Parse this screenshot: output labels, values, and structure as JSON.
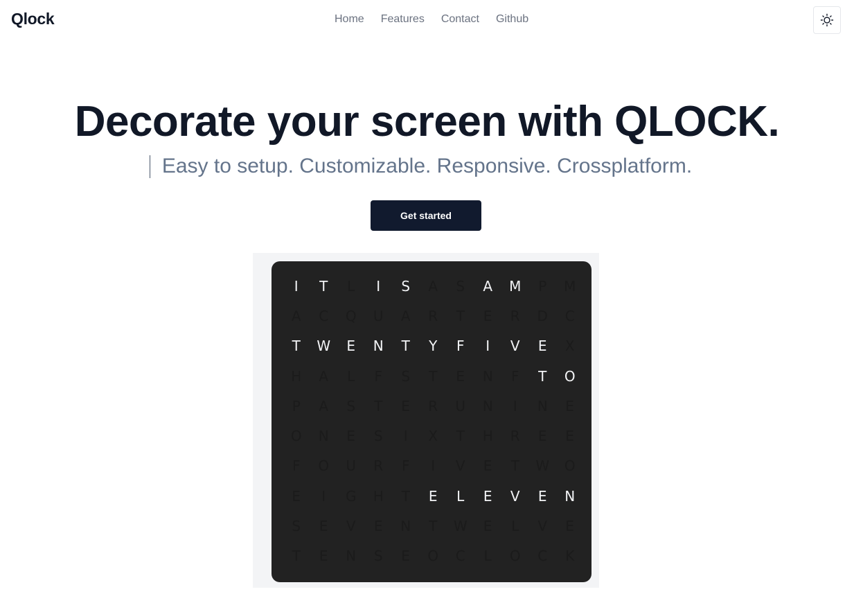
{
  "brand": "Qlock",
  "nav": {
    "links": [
      "Home",
      "Features",
      "Contact",
      "Github"
    ]
  },
  "theme_toggle": {
    "icon": "sun-icon"
  },
  "hero": {
    "title": "Decorate your screen with QLOCK.",
    "subtitle": "Easy to setup. Customizable. Responsive. Crossplatform.",
    "cta_label": "Get started"
  },
  "clock": {
    "rows": [
      "ITLISASAMPM",
      "ACQUARTERDC",
      "TWENTYFIVEX",
      "HALFSTENFTO",
      "PASTERUNINE",
      "ONESIXTHREE",
      "FOURFIVETWO",
      "EIGHTELEVEN",
      "SEVENTWELVE",
      "TENSEOCLOCK"
    ],
    "lit": [
      [
        0,
        0
      ],
      [
        0,
        1
      ],
      [
        0,
        3
      ],
      [
        0,
        4
      ],
      [
        0,
        7
      ],
      [
        0,
        8
      ],
      [
        2,
        0
      ],
      [
        2,
        1
      ],
      [
        2,
        2
      ],
      [
        2,
        3
      ],
      [
        2,
        4
      ],
      [
        2,
        5
      ],
      [
        2,
        6
      ],
      [
        2,
        7
      ],
      [
        2,
        8
      ],
      [
        2,
        9
      ],
      [
        3,
        9
      ],
      [
        3,
        10
      ],
      [
        7,
        5
      ],
      [
        7,
        6
      ],
      [
        7,
        7
      ],
      [
        7,
        8
      ],
      [
        7,
        9
      ],
      [
        7,
        10
      ]
    ],
    "colors": {
      "face": "#222222",
      "lit": "#f3f4f6",
      "dim": "#1b1b1b"
    }
  }
}
